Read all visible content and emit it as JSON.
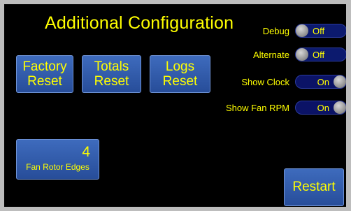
{
  "screen": {
    "title": "Additional Configuration"
  },
  "buttons": {
    "factory_reset": [
      "Factory",
      "Reset"
    ],
    "totals_reset": [
      "Totals",
      "Reset"
    ],
    "logs_reset": [
      "Logs",
      "Reset"
    ],
    "fan_rotor_edges": {
      "value": "4",
      "label": "Fan Rotor Edges"
    },
    "restart": "Restart"
  },
  "toggles": [
    {
      "label": "Debug",
      "state": "Off"
    },
    {
      "label": "Alternate",
      "state": "Off"
    },
    {
      "label": "Show Clock",
      "state": "On"
    },
    {
      "label": "Show Fan RPM",
      "state": "On"
    }
  ],
  "colors": {
    "background": "#000000",
    "text": "#ffff00",
    "button": "#2f5aaa",
    "toggle_track": "#0b1366",
    "knob": "#a0a0a0"
  }
}
